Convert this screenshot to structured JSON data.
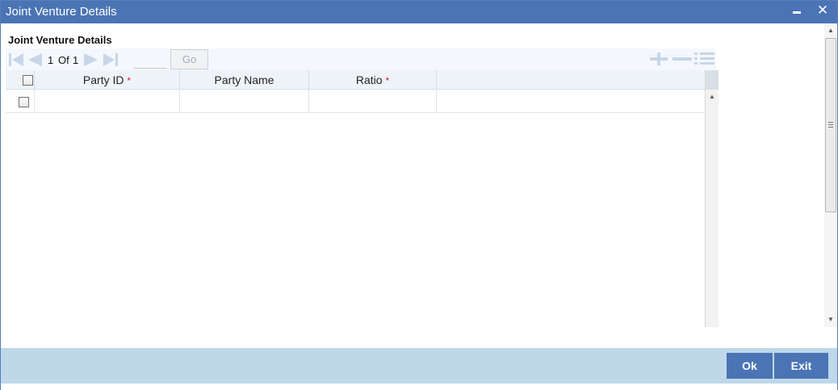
{
  "window": {
    "title": "Joint Venture Details",
    "minimize_icon": "minimize-icon",
    "close_icon": "close-icon",
    "close_glyph": "✕"
  },
  "section": {
    "title": "Joint Venture Details"
  },
  "pager": {
    "current": "1",
    "of_label": "Of",
    "total": "1",
    "page_input_value": "",
    "go_label": "Go",
    "icons": [
      "first-page-icon",
      "previous-page-icon",
      "next-page-icon",
      "last-page-icon"
    ],
    "toolbar_icons": [
      "add-row-icon",
      "delete-row-icon",
      "single-view-icon"
    ]
  },
  "grid": {
    "columns": [
      {
        "label": "Party ID",
        "required": true
      },
      {
        "label": "Party Name",
        "required": false
      },
      {
        "label": "Ratio",
        "required": true
      }
    ],
    "required_marker": "*",
    "rows": [
      {
        "checked": false,
        "party_id": "",
        "party_name": "",
        "ratio": ""
      }
    ]
  },
  "footer": {
    "ok_label": "Ok",
    "exit_label": "Exit"
  },
  "colors": {
    "titlebar": "#4a74b4",
    "footer": "#bed8ea",
    "button": "#4a74b4",
    "required": "#d0202a"
  }
}
